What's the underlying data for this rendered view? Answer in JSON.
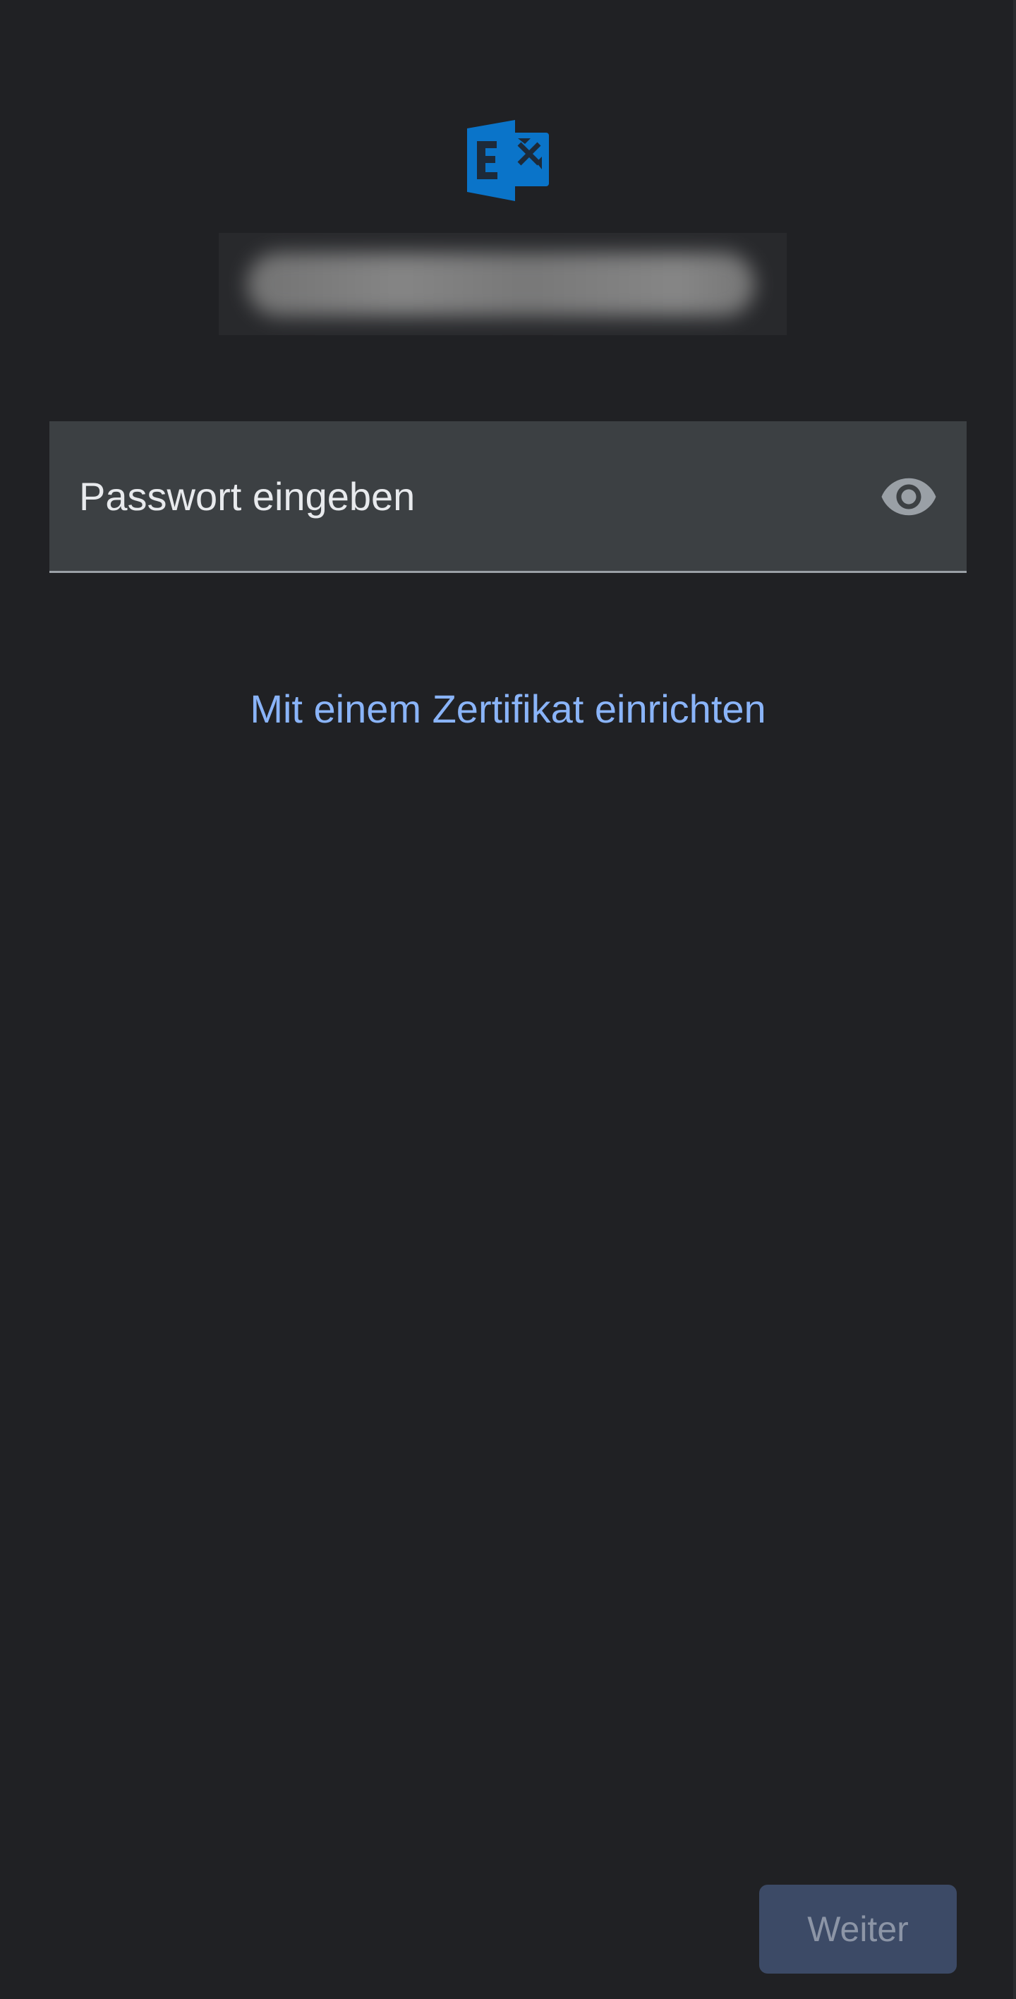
{
  "app": {
    "logo_icon": "exchange-logo-icon",
    "accent_color": "#0a74c9",
    "link_color": "#8ab4f8"
  },
  "account": {
    "name": ""
  },
  "password": {
    "value": "",
    "placeholder": "Passwort eingeben",
    "toggle_icon": "eye-icon",
    "toggle_label": "Passwort anzeigen"
  },
  "certificate_link": {
    "label": "Mit einem Zertifikat einrichten"
  },
  "footer": {
    "next_label": "Weiter",
    "next_enabled": false
  }
}
